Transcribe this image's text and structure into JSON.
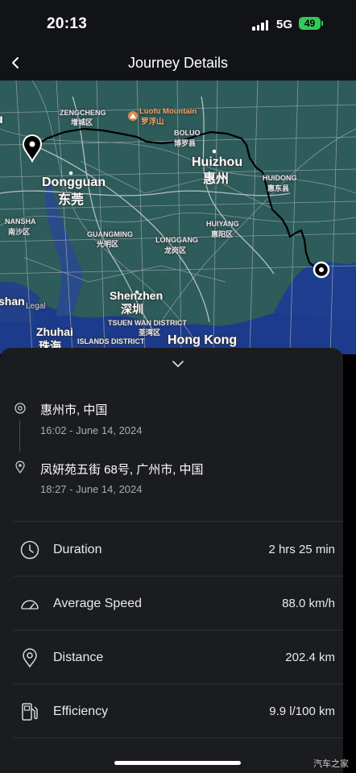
{
  "status_bar": {
    "time": "20:13",
    "network": "5G",
    "battery": "49"
  },
  "nav": {
    "title": "Journey Details"
  },
  "map": {
    "labels": {
      "zengcheng_en": "ZENGCHENG",
      "zengcheng_zh": "增城区",
      "luofu_en": "Luofu Mountain",
      "luofu_zh": "罗浮山",
      "boluo_en": "BOLUO",
      "boluo_zh": "博罗县",
      "huizhou_en": "Huizhou",
      "huizhou_zh": "惠州",
      "huidong_en": "HUIDONG",
      "huidong_zh": "惠东县",
      "dongguan_en": "Dongguan",
      "dongguan_zh": "东莞",
      "nansha_en": "NANSHA",
      "nansha_zh": "南沙区",
      "guangming_en": "GUANGMING",
      "guangming_zh": "光明区",
      "longgang_en": "LONGGANG",
      "longgang_zh": "龙岗区",
      "huiyang_en": "HUIYANG",
      "huiyang_zh": "惠阳区",
      "shenzhen_en": "Shenzhen",
      "shenzhen_zh": "深圳",
      "tsuenwan_en": "TSUEN WAN DISTRICT",
      "tsuenwan_zh": "荃湾区",
      "islands": "ISLANDS DISTRICT",
      "hongkong": "Hong Kong",
      "zhuhai_en": "Zhuhai",
      "zhuhai_zh": "珠海",
      "zhongshan": "shan",
      "legal": "Legal",
      "gu": "u"
    }
  },
  "journey": {
    "start": {
      "address": "惠州市, 中国",
      "time": "16:02 - June 14, 2024"
    },
    "end": {
      "address": "凤妍苑五街 68号, 广州市, 中国",
      "time": "18:27 - June 14, 2024"
    }
  },
  "stats": [
    {
      "label": "Duration",
      "value": "2 hrs 25 min",
      "icon": "clock-icon"
    },
    {
      "label": "Average Speed",
      "value": "88.0 km/h",
      "icon": "speedometer-icon"
    },
    {
      "label": "Distance",
      "value": "202.4 km",
      "icon": "location-pin-icon"
    },
    {
      "label": "Efficiency",
      "value": "9.9 l/100 km",
      "icon": "fuel-pump-icon"
    }
  ],
  "watermark": "汽车之家",
  "colors": {
    "land": "#2f5d5a",
    "water": "#1f3d8a",
    "roads": "#9aa3ad",
    "route": "#000000",
    "battery": "#34c759"
  }
}
